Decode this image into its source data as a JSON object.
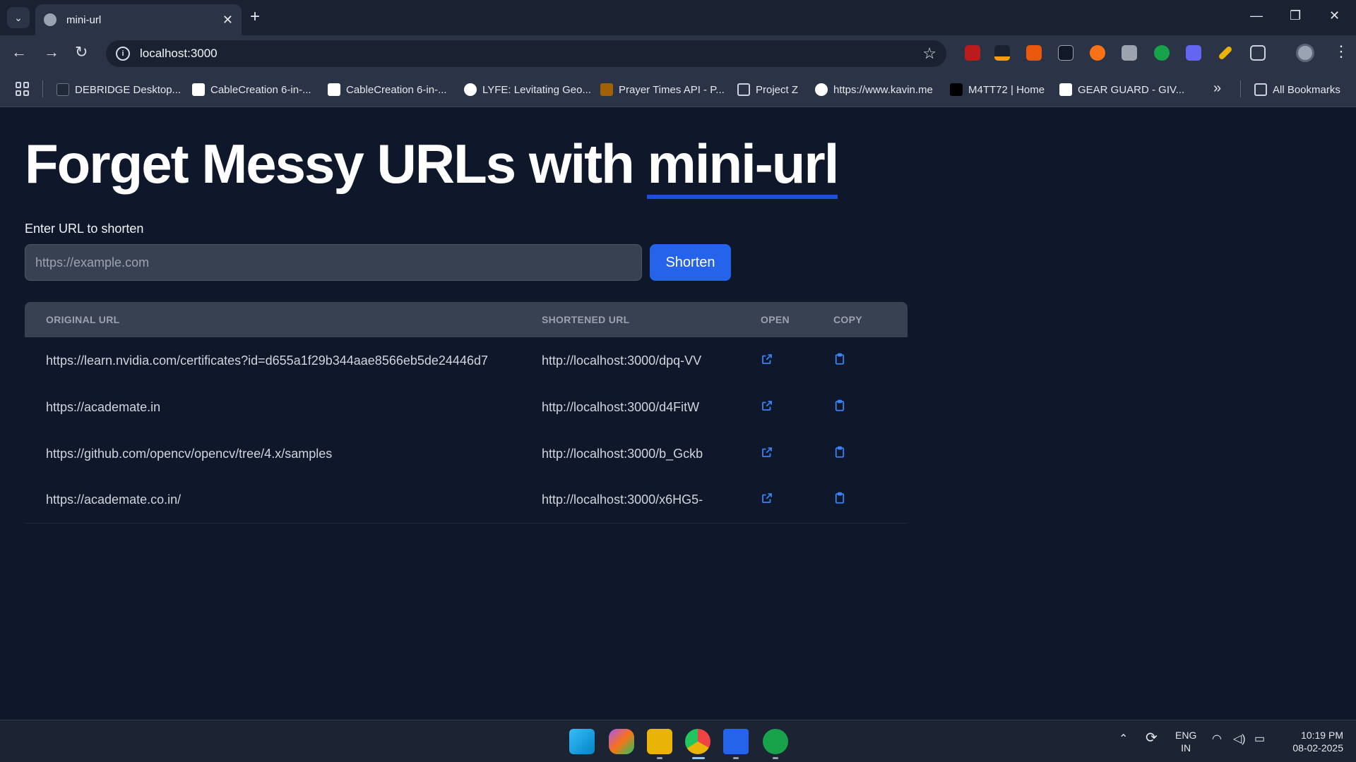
{
  "browser": {
    "tab_title": "mini-url",
    "address": "localhost:3000",
    "bookmarks": [
      "DEBRIDGE Desktop...",
      "CableCreation 6-in-...",
      "CableCreation 6-in-...",
      "LYFE: Levitating Geo...",
      "Prayer Times API - P...",
      "Project Z",
      "https://www.kavin.me",
      "M4TT72 | Home",
      "GEAR GUARD - GIV..."
    ],
    "all_bookmarks": "All Bookmarks"
  },
  "page": {
    "headline_prefix": "Forget Messy URLs with ",
    "headline_brand": "mini-url",
    "input_label": "Enter URL to shorten",
    "input_placeholder": "https://example.com",
    "input_value": "",
    "shorten_label": "Shorten",
    "table": {
      "headers": [
        "ORIGINAL URL",
        "SHORTENED URL",
        "OPEN",
        "COPY"
      ],
      "rows": [
        {
          "original": "https://learn.nvidia.com/certificates?id=d655a1f29b344aae8566eb5de24446d7",
          "short": "http://localhost:3000/dpq-VV"
        },
        {
          "original": "https://academate.in",
          "short": "http://localhost:3000/d4FitW"
        },
        {
          "original": "https://github.com/opencv/opencv/tree/4.x/samples",
          "short": "http://localhost:3000/b_Gckb"
        },
        {
          "original": "https://academate.co.in/",
          "short": "http://localhost:3000/x6HG5-"
        }
      ]
    }
  },
  "taskbar": {
    "lang_top": "ENG",
    "lang_bottom": "IN",
    "time": "10:19 PM",
    "date": "08-02-2025"
  },
  "colors": {
    "accent": "#2563eb",
    "underline": "#1d4ed8",
    "background": "#0f172a"
  }
}
